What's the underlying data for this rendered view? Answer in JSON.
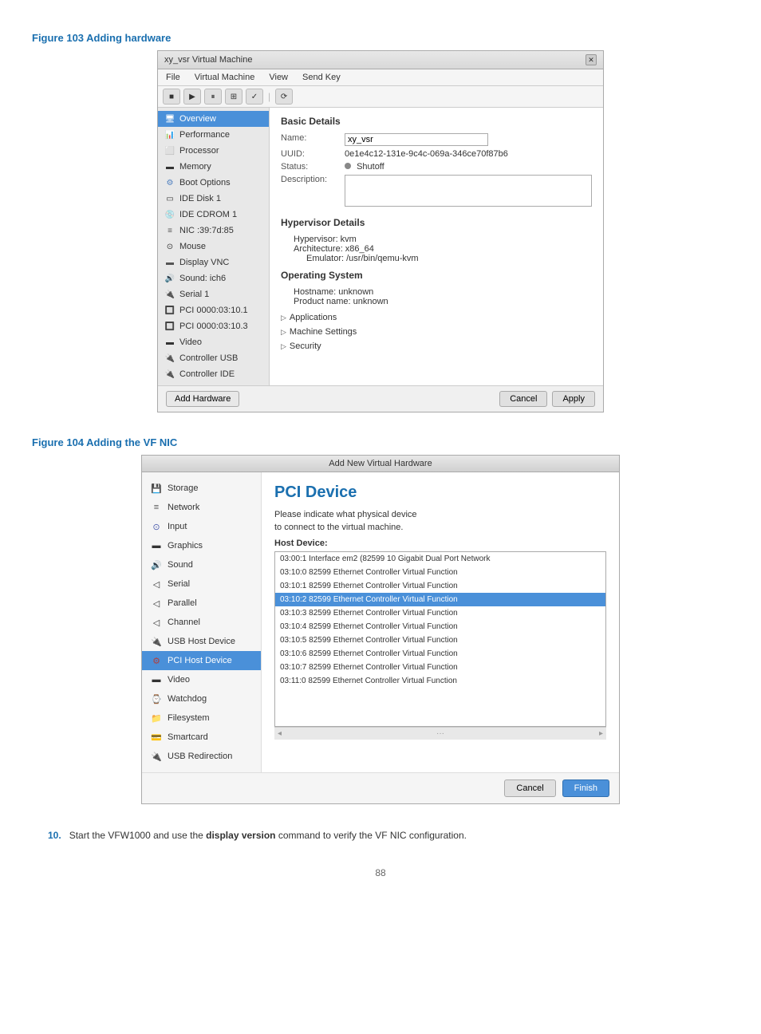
{
  "figure103": {
    "title": "Figure 103 Adding hardware",
    "window_title": "xy_vsr Virtual Machine",
    "menu_items": [
      "File",
      "Virtual Machine",
      "View",
      "Send Key"
    ],
    "toolbar_buttons": [
      "■",
      "▶",
      "⏸",
      "⊞",
      "✓",
      "⟳"
    ],
    "sidebar_items": [
      {
        "label": "Overview",
        "icon": "🖥",
        "selected": true
      },
      {
        "label": "Performance",
        "icon": "📊"
      },
      {
        "label": "Processor",
        "icon": "⬜"
      },
      {
        "label": "Memory",
        "icon": "▬"
      },
      {
        "label": "Boot Options",
        "icon": "⚙"
      },
      {
        "label": "IDE Disk 1",
        "icon": "▭"
      },
      {
        "label": "IDE CDROM 1",
        "icon": "💿"
      },
      {
        "label": "NIC :39:7d:85",
        "icon": "📶"
      },
      {
        "label": "Mouse",
        "icon": "🖱"
      },
      {
        "label": "Display VNC",
        "icon": "🖥"
      },
      {
        "label": "Sound: ich6",
        "icon": "🔊"
      },
      {
        "label": "Serial 1",
        "icon": "🔌"
      },
      {
        "label": "PCI 0000:03:10.1",
        "icon": "🔲"
      },
      {
        "label": "PCI 0000:03:10.3",
        "icon": "🔲"
      },
      {
        "label": "Video",
        "icon": "🎞"
      },
      {
        "label": "Controller USB",
        "icon": "🔌"
      },
      {
        "label": "Controller IDE",
        "icon": "🔌"
      }
    ],
    "basic_details": {
      "title": "Basic Details",
      "name_label": "Name:",
      "name_value": "xy_vsr",
      "uuid_label": "UUID:",
      "uuid_value": "0e1e4c12-131e-9c4c-069a-346ce70f87b6",
      "status_label": "Status:",
      "status_value": "Shutoff",
      "description_label": "Description:"
    },
    "hypervisor_details": {
      "title": "Hypervisor Details",
      "hypervisor": "Hypervisor:  kvm",
      "architecture": "Architecture:  x86_64",
      "emulator": "Emulator:  /usr/bin/qemu-kvm"
    },
    "operating_system": {
      "title": "Operating System",
      "hostname": "Hostname:  unknown",
      "product": "Product name:  unknown"
    },
    "expand_sections": [
      "Applications",
      "Machine Settings",
      "Security"
    ],
    "footer": {
      "add_button": "Add Hardware",
      "cancel_button": "Cancel",
      "apply_button": "Apply"
    }
  },
  "figure104": {
    "title": "Figure 104 Adding the VF NIC",
    "window_title": "Add New Virtual Hardware",
    "sidebar_items": [
      {
        "label": "Storage",
        "icon": "💾"
      },
      {
        "label": "Network",
        "icon": "📶"
      },
      {
        "label": "Input",
        "icon": "🖱"
      },
      {
        "label": "Graphics",
        "icon": "🖼"
      },
      {
        "label": "Sound",
        "icon": "🔊"
      },
      {
        "label": "Serial",
        "icon": "📄"
      },
      {
        "label": "Parallel",
        "icon": "📄"
      },
      {
        "label": "Channel",
        "icon": "📄"
      },
      {
        "label": "USB Host Device",
        "icon": "🔌"
      },
      {
        "label": "PCI Host Device",
        "icon": "⚙",
        "selected": true
      },
      {
        "label": "Video",
        "icon": "🎞"
      },
      {
        "label": "Watchdog",
        "icon": "⌚"
      },
      {
        "label": "Filesystem",
        "icon": "📁"
      },
      {
        "label": "Smartcard",
        "icon": "💳"
      },
      {
        "label": "USB Redirection",
        "icon": "🔌"
      }
    ],
    "content": {
      "device_type": "PCI Device",
      "description_line1": "Please indicate what physical device",
      "description_line2": "to connect to the virtual machine.",
      "host_device_label": "Host Device:",
      "devices": [
        {
          "text": "03:00:1 Interface em2 (82599 10 Gigabit Dual Port Network",
          "selected": false
        },
        {
          "text": "03:10:0 82599 Ethernet Controller Virtual Function",
          "selected": false
        },
        {
          "text": "03:10:1 82599 Ethernet Controller Virtual Function",
          "selected": false
        },
        {
          "text": "03:10:2 82599 Ethernet Controller Virtual Function",
          "selected": true
        },
        {
          "text": "03:10:3 82599 Ethernet Controller Virtual Function",
          "selected": false
        },
        {
          "text": "03:10:4 82599 Ethernet Controller Virtual Function",
          "selected": false
        },
        {
          "text": "03:10:5 82599 Ethernet Controller Virtual Function",
          "selected": false
        },
        {
          "text": "03:10:6 82599 Ethernet Controller Virtual Function",
          "selected": false
        },
        {
          "text": "03:10:7 82599 Ethernet Controller Virtual Function",
          "selected": false
        },
        {
          "text": "03:11:0 82599 Ethernet Controller Virtual Function",
          "selected": false
        }
      ]
    },
    "footer": {
      "cancel_button": "Cancel",
      "finish_button": "Finish"
    }
  },
  "step10": {
    "number": "10.",
    "text_before": "Start the VFW1000 and use the ",
    "bold_part": "display version",
    "text_after": " command to verify the VF NIC configuration."
  },
  "page_number": "88"
}
